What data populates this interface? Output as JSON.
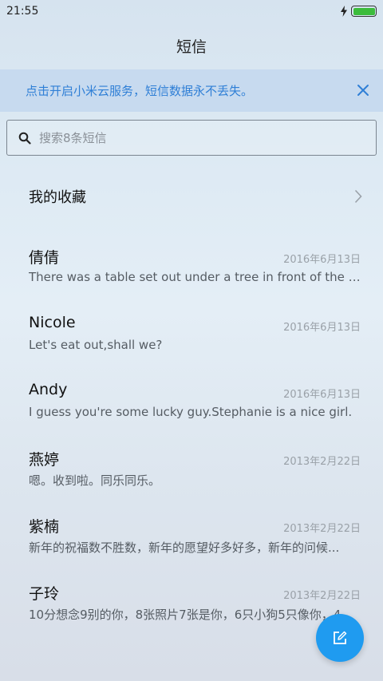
{
  "status_bar": {
    "time": "21:55"
  },
  "title": "短信",
  "banner": {
    "text": "点击开启小米云服务，短信数据永不丢失。"
  },
  "search": {
    "placeholder": "搜索8条短信"
  },
  "favorites": {
    "label": "我的收藏"
  },
  "conversations": [
    {
      "name": "倩倩",
      "date": "2016年6月13日",
      "preview": "There was a table set out under a tree in front of the ho..."
    },
    {
      "name": "Nicole",
      "date": "2016年6月13日",
      "preview": "Let's eat out,shall we?"
    },
    {
      "name": "Andy",
      "date": "2016年6月13日",
      "preview": "I guess you're some lucky guy.Stephanie is a nice girl."
    },
    {
      "name": "燕婷",
      "date": "2013年2月22日",
      "preview": "嗯。收到啦。同乐同乐。"
    },
    {
      "name": "紫楠",
      "date": "2013年2月22日",
      "preview": "新年的祝福数不胜数，新年的愿望好多好多，新年的问候..."
    },
    {
      "name": "子玲",
      "date": "2013年2月22日",
      "preview": "10分想念9别的你，8张照片7张是你，6只小狗5只像你，4..."
    }
  ],
  "colors": {
    "accent": "#1f9bf0",
    "banner_bg": "#c7daef",
    "banner_text": "#2f7fd6",
    "battery": "#3cbc3c"
  },
  "icons": {
    "search": "search-icon",
    "close": "close-icon",
    "chevron": "chevron-right-icon",
    "compose": "compose-icon",
    "charging": "charging-bolt-icon",
    "battery": "battery-icon"
  }
}
